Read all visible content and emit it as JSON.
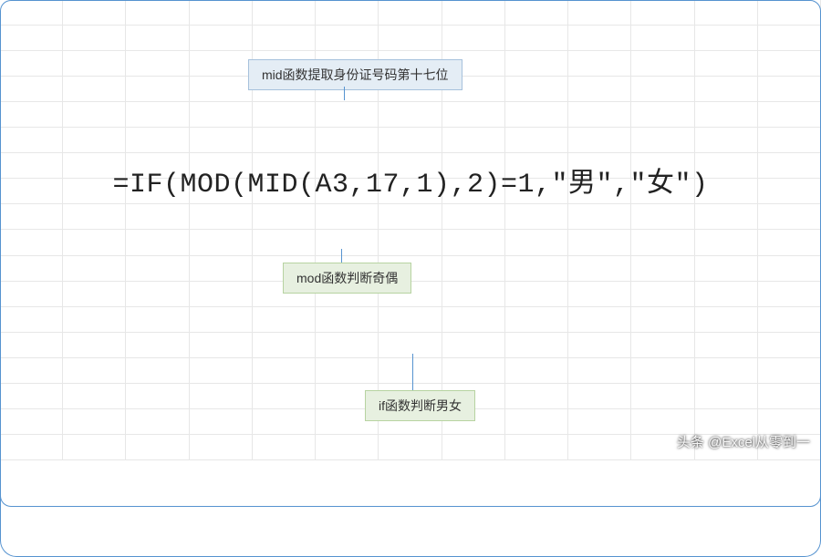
{
  "formula": "=IF(MOD(MID(A3,17,1),2)=1,\"男\",\"女\")",
  "annotations": {
    "mid": "mid函数提取身份证号码第十七位",
    "mod": "mod函数判断奇偶",
    "if": "if函数判断男女"
  },
  "watermark": "头条 @Excel从零到一"
}
